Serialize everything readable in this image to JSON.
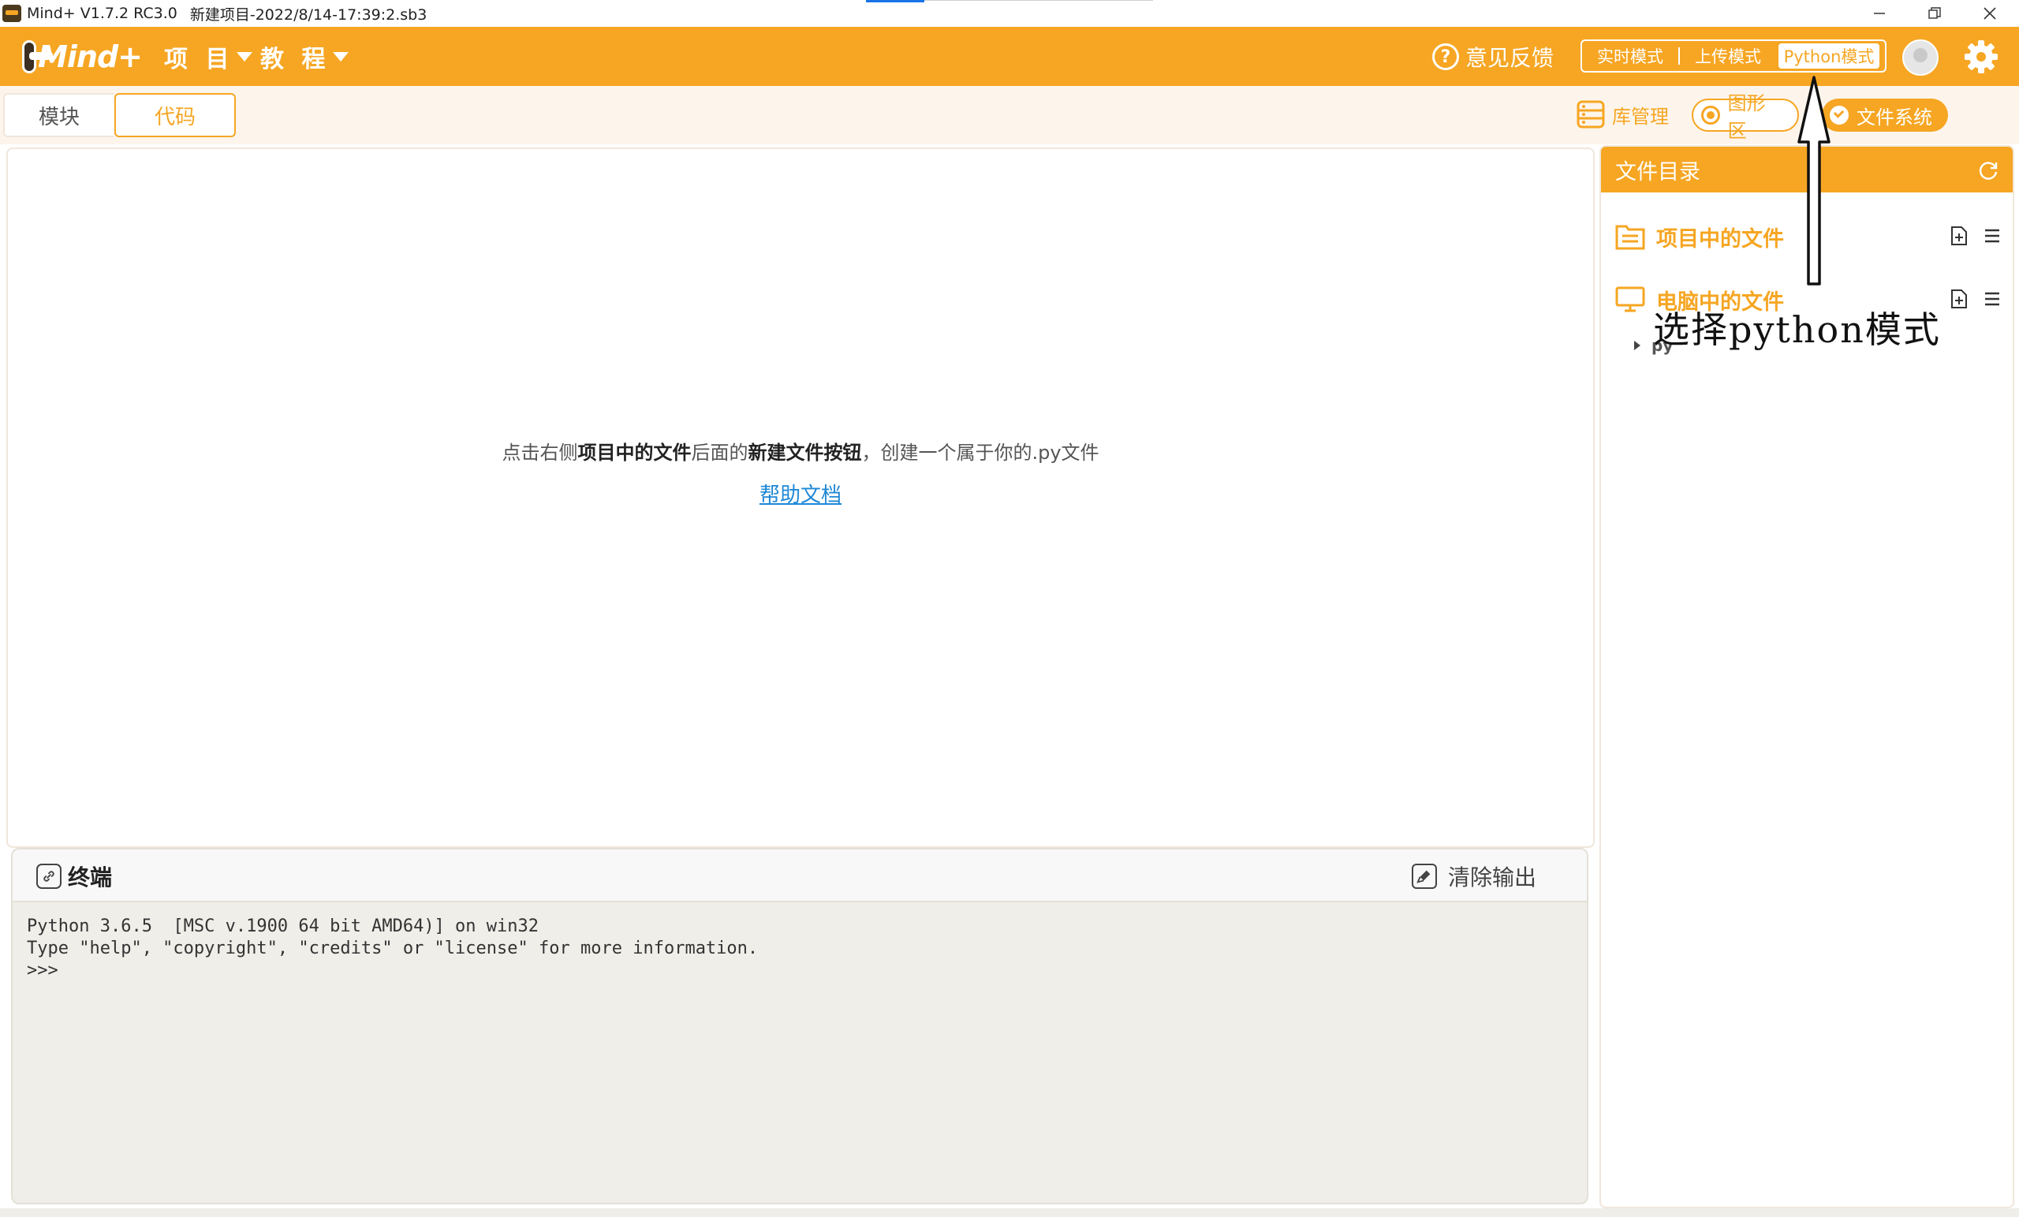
{
  "window": {
    "app_title": "Mind+ V1.7.2 RC3.0",
    "file_title": "新建项目-2022/8/14-17:39:2.sb3"
  },
  "menubar": {
    "logo_text": "Mind+",
    "project_label": "项 目",
    "tutorial_label": "教 程",
    "feedback_label": "意见反馈",
    "modes": {
      "realtime": "实时模式",
      "upload": "上传模式",
      "python": "Python模式"
    },
    "active_mode": "python"
  },
  "tabs": {
    "blocks": "模块",
    "code": "代码",
    "active": "code"
  },
  "toolbar": {
    "lib_manage": "库管理",
    "graph_area": "图形区",
    "file_system": "文件系统"
  },
  "editor": {
    "hint_prefix": "点击右侧",
    "hint_bold1": "项目中的文件",
    "hint_middle": "后面的",
    "hint_bold2": "新建文件按钮",
    "hint_suffix": "，创建一个属于你的.py文件",
    "help_link": "帮助文档"
  },
  "terminal": {
    "title": "终端",
    "clear_label": "清除输出",
    "lines": [
      "Python 3.6.5  [MSC v.1900 64 bit AMD64)] on win32",
      "Type \"help\", \"copyright\", \"credits\" or \"license\" for more information.",
      ">>>"
    ]
  },
  "file_directory": {
    "title": "文件目录",
    "project_files": "项目中的文件",
    "computer_files": "电脑中的文件",
    "folder": "py"
  },
  "annotation": {
    "text": "选择python模式"
  },
  "colors": {
    "accent": "#f6a623",
    "link": "#1e88d6",
    "terminal_bg": "#f0eee9"
  }
}
